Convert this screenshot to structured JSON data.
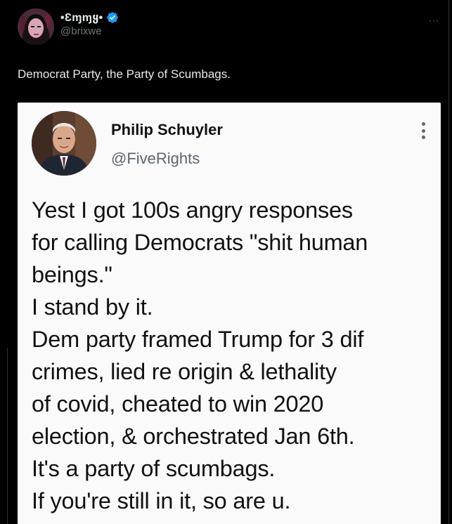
{
  "author": {
    "display_name": "•Ɛɱɱყ•",
    "handle": "@brixwe",
    "verified": true
  },
  "tweet": {
    "text": "Democrat Party, the Party of Scumbags."
  },
  "more_icon": "more-horizontal-icon",
  "embedded": {
    "name": "Philip Schuyler",
    "handle": "@FiveRights",
    "menu_icon": "more-vertical-icon",
    "lines": [
      "Yest I got 100s angry responses",
      "for calling Democrats \"shit human",
      "beings.\"",
      "I stand by it.",
      "Dem party framed Trump for 3 dif",
      "crimes, lied re origin & lethality",
      "of covid, cheated to win 2020",
      "election, & orchestrated Jan 6th.",
      "It's a party of scumbags.",
      "If you're still in it, so are u."
    ]
  },
  "colors": {
    "background": "#000000",
    "text_primary": "#e7e9ea",
    "text_secondary": "#71767b",
    "verified_blue": "#1d9bf0",
    "card_background": "#fafafa"
  }
}
